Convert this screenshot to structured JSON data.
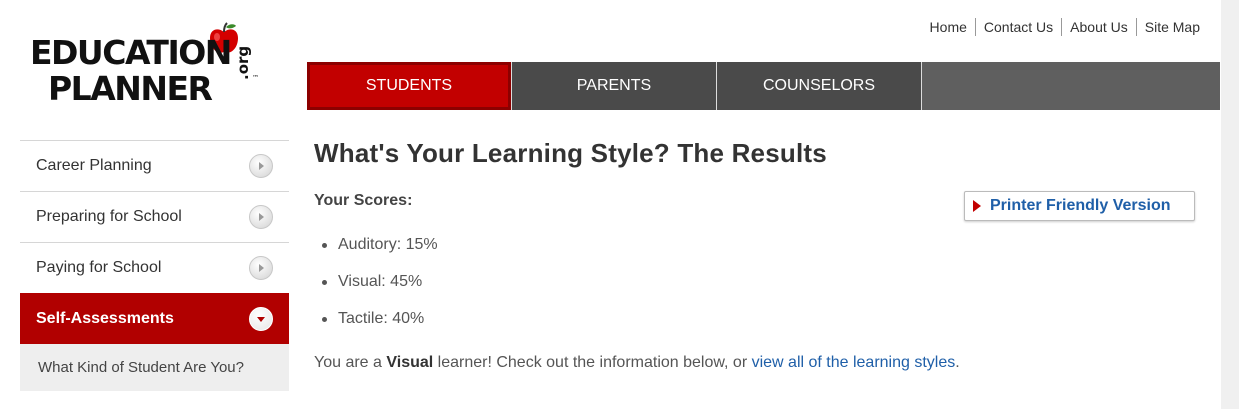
{
  "logo": {
    "line1": "EDUCATION",
    "line2": "PLANNER",
    "suffix": ".org",
    "tm": "™",
    "apple_color": "#d40000",
    "leaf_color": "#3a8a2a"
  },
  "utility_nav": [
    "Home",
    "Contact Us",
    "About Us",
    "Site Map"
  ],
  "main_nav": {
    "tabs": [
      {
        "label": "STUDENTS",
        "active": true
      },
      {
        "label": "PARENTS",
        "active": false
      },
      {
        "label": "COUNSELORS",
        "active": false
      }
    ]
  },
  "sidebar": {
    "items": [
      {
        "label": "Career Planning",
        "icon": "arrow-right-icon"
      },
      {
        "label": "Preparing for School",
        "icon": "arrow-right-icon"
      },
      {
        "label": "Paying for School",
        "icon": "arrow-right-icon"
      },
      {
        "label": "Self-Assessments",
        "icon": "arrow-down-icon",
        "active": true
      }
    ],
    "subitem": "What Kind of Student Are You?"
  },
  "content": {
    "title": "What's Your Learning Style? The Results",
    "scores_heading": "Your Scores:",
    "scores": [
      "Auditory: 15%",
      "Visual: 45%",
      "Tactile: 40%"
    ],
    "result": {
      "prefix": "You are a ",
      "style": "Visual",
      "middle": " learner! Check out the information below, or ",
      "link": "view all of the learning styles",
      "suffix": "."
    },
    "printer_button": "Printer Friendly Version"
  },
  "colors": {
    "brand_red": "#c20000",
    "nav_gray": "#4a4a4a",
    "link_blue": "#1f5fa8"
  }
}
